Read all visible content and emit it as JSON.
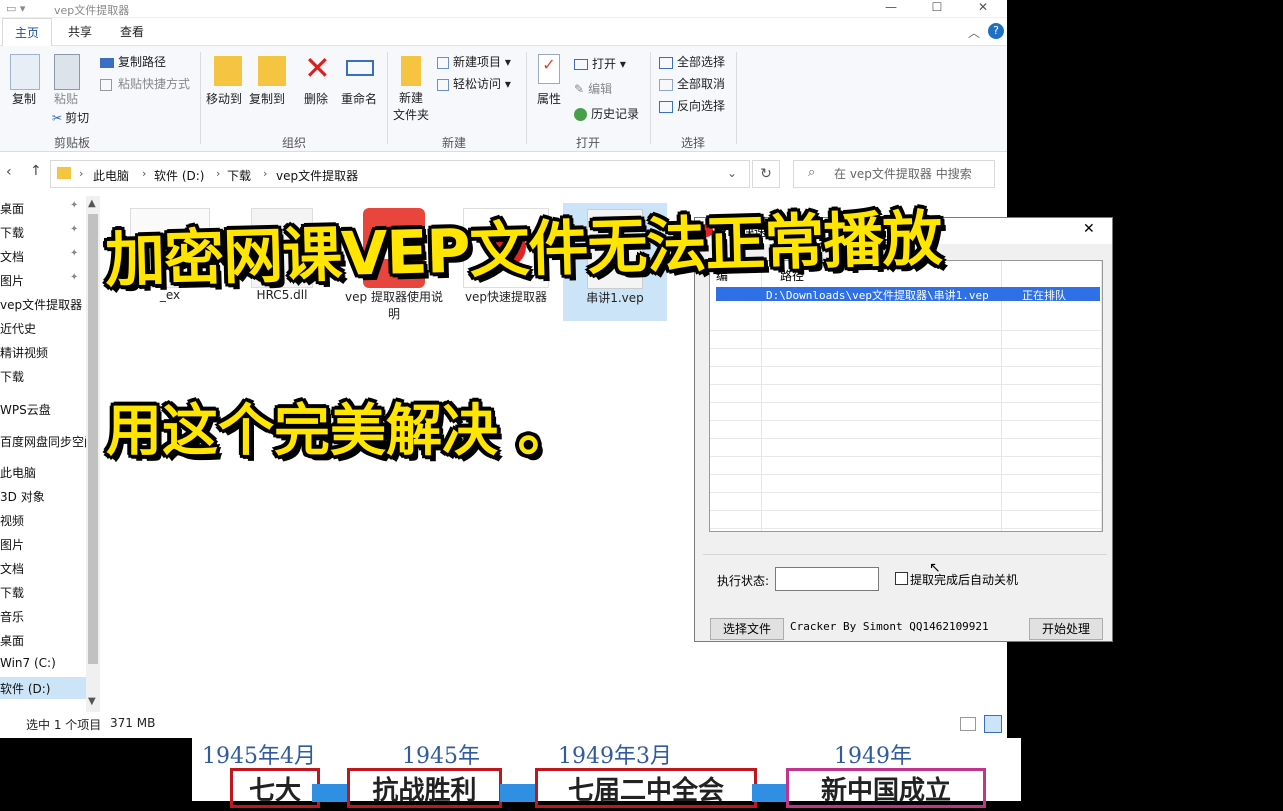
{
  "explorer": {
    "window_title": "vep文件提取器",
    "tabs": [
      "主页",
      "共享",
      "查看"
    ],
    "ribbon": {
      "clipboard": {
        "copy": "复制",
        "paste": "粘贴",
        "copy_path": "复制路径",
        "paste_shortcut": "粘贴快捷方式",
        "cut": "剪切",
        "group": "剪贴板"
      },
      "organize": {
        "move_to": "移动到",
        "copy_to": "复制到",
        "delete": "删除",
        "rename": "重命名",
        "group": "组织"
      },
      "new": {
        "new_folder_line1": "新建",
        "new_folder_line2": "文件夹",
        "new_item": "新建项目",
        "easy_access": "轻松访问",
        "group": "新建"
      },
      "open": {
        "properties": "属性",
        "open": "打开",
        "edit": "编辑",
        "history": "历史记录",
        "group": "打开"
      },
      "select": {
        "select_all": "全部选择",
        "select_none": "全部取消",
        "invert": "反向选择",
        "group": "选择"
      }
    },
    "breadcrumb": [
      "此电脑",
      "软件 (D:)",
      "下载",
      "vep文件提取器"
    ],
    "search_placeholder": "在 vep文件提取器 中搜索",
    "nav_items": [
      "桌面",
      "下载",
      "文档",
      "图片",
      "vep文件提取器",
      "近代史",
      "精讲视频",
      "下载",
      "WPS云盘",
      "百度网盘同步空间",
      "此电脑",
      "3D 对象",
      "视频",
      "图片",
      "文档",
      "下载",
      "音乐",
      "桌面",
      "Win7 (C:)",
      "软件 (D:)"
    ],
    "files": [
      {
        "name": "_ex"
      },
      {
        "name": "HRC5.dll"
      },
      {
        "name": "vep 提取器使用说明"
      },
      {
        "name": "vep快速提取器"
      },
      {
        "name": "串讲1.vep"
      }
    ],
    "status": {
      "selected": "选中 1 个项目",
      "size": "371 MB"
    }
  },
  "vep_dialog": {
    "title": "VEP快速提取器",
    "close": "✕",
    "col_headers": [
      "编",
      "路径"
    ],
    "row": {
      "path": "D:\\Downloads\\vep文件提取器\\串讲1.vep",
      "status": "正在排队"
    },
    "exec_status_label": "执行状态:",
    "auto_shutdown_label": "提取完成后自动关机",
    "select_file_btn": "选择文件",
    "credit": "Cracker By Simont QQ1462109921",
    "start_btn": "开始处理"
  },
  "overlay": {
    "line1": "加密网课VEP文件无法正常播放",
    "line2": "用这个完美解决 。"
  },
  "timeline": {
    "years": [
      "1945年4月",
      "1945年",
      "1949年3月",
      "1949年"
    ],
    "events": [
      "七大",
      "抗战胜利",
      "七届二中全会",
      "新中国成立"
    ]
  },
  "colors": {
    "caption": "#ffe500",
    "accent": "#3070e6",
    "selection": "#cce4f7"
  }
}
